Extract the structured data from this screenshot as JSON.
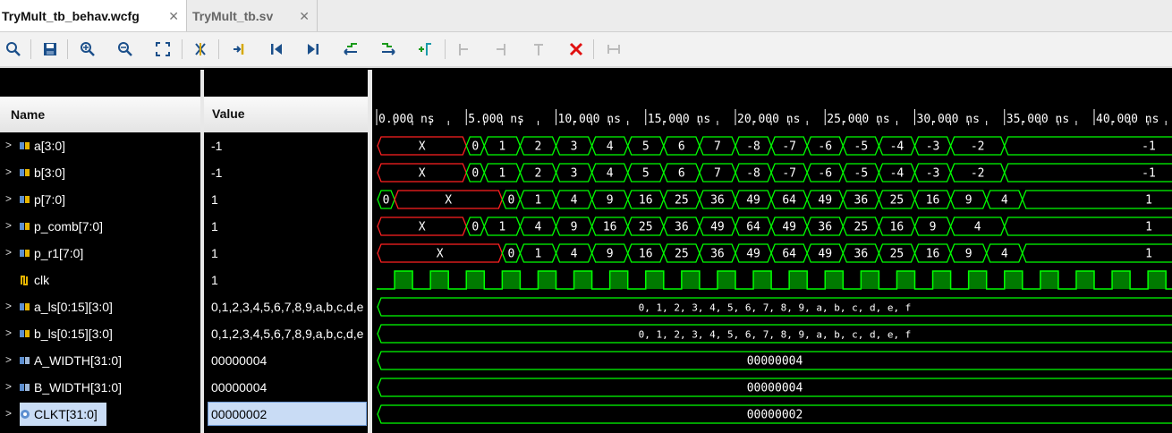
{
  "tabs": [
    {
      "label": "TryMult_tb_behav.wcfg",
      "active": true
    },
    {
      "label": "TryMult_tb.sv",
      "active": false
    }
  ],
  "toolbar_icons": [
    "search-icon",
    "save-icon",
    "zoom-in-icon",
    "zoom-out-icon",
    "zoom-fit-icon",
    "cursor-icon",
    "go-to-cursor-icon",
    "go-to-time-zero-icon",
    "go-to-last-time-icon",
    "previous-transition-icon",
    "next-transition-icon",
    "add-marker-icon",
    "previous-marker-icon",
    "next-marker-icon",
    "swap-cursors-icon",
    "delete-icon",
    "snap-icon"
  ],
  "headers": {
    "name": "Name",
    "value": "Value"
  },
  "colors": {
    "waveform": "#00ff00",
    "x_state": "#ff2020",
    "clock_fill": "#007a00",
    "selection": "#c9dcf5"
  },
  "time_axis": {
    "labels": [
      "0.000 ns",
      "5.000 ns",
      "10.000 ns",
      "15.000 ns",
      "20.000 ns",
      "25.000 ns",
      "30.000 ns",
      "35.000 ns",
      "40.000 ns"
    ],
    "ns_per_tick": 5,
    "visible_range_ns": [
      0,
      44.5
    ]
  },
  "signals": [
    {
      "name": "a[3:0]",
      "value": "-1",
      "icon": "bus-icon",
      "expandable": true,
      "wave": {
        "type": "bus",
        "segs": [
          [
            0,
            5,
            "X"
          ],
          [
            5,
            6,
            "0"
          ],
          [
            6,
            8,
            "1"
          ],
          [
            8,
            10,
            "2"
          ],
          [
            10,
            12,
            "3"
          ],
          [
            12,
            14,
            "4"
          ],
          [
            14,
            16,
            "5"
          ],
          [
            16,
            18,
            "6"
          ],
          [
            18,
            20,
            "7"
          ],
          [
            20,
            22,
            "-8"
          ],
          [
            22,
            24,
            "-7"
          ],
          [
            24,
            26,
            "-6"
          ],
          [
            26,
            28,
            "-5"
          ],
          [
            28,
            30,
            "-4"
          ],
          [
            30,
            32,
            "-3"
          ],
          [
            32,
            35,
            "-2"
          ],
          [
            35,
            null,
            "-1"
          ]
        ]
      }
    },
    {
      "name": "b[3:0]",
      "value": "-1",
      "icon": "bus-icon",
      "expandable": true,
      "wave": {
        "type": "bus",
        "segs": [
          [
            0,
            5,
            "X"
          ],
          [
            5,
            6,
            "0"
          ],
          [
            6,
            8,
            "1"
          ],
          [
            8,
            10,
            "2"
          ],
          [
            10,
            12,
            "3"
          ],
          [
            12,
            14,
            "4"
          ],
          [
            14,
            16,
            "5"
          ],
          [
            16,
            18,
            "6"
          ],
          [
            18,
            20,
            "7"
          ],
          [
            20,
            22,
            "-8"
          ],
          [
            22,
            24,
            "-7"
          ],
          [
            24,
            26,
            "-6"
          ],
          [
            26,
            28,
            "-5"
          ],
          [
            28,
            30,
            "-4"
          ],
          [
            30,
            32,
            "-3"
          ],
          [
            32,
            35,
            "-2"
          ],
          [
            35,
            null,
            "-1"
          ]
        ]
      }
    },
    {
      "name": "p[7:0]",
      "value": "1",
      "icon": "bus-icon",
      "expandable": true,
      "wave": {
        "type": "bus",
        "segs": [
          [
            0,
            1,
            "0"
          ],
          [
            1,
            7,
            "X"
          ],
          [
            7,
            8,
            "0"
          ],
          [
            8,
            10,
            "1"
          ],
          [
            10,
            12,
            "4"
          ],
          [
            12,
            14,
            "9"
          ],
          [
            14,
            16,
            "16"
          ],
          [
            16,
            18,
            "25"
          ],
          [
            18,
            20,
            "36"
          ],
          [
            20,
            22,
            "49"
          ],
          [
            22,
            24,
            "64"
          ],
          [
            24,
            26,
            "49"
          ],
          [
            26,
            28,
            "36"
          ],
          [
            28,
            30,
            "25"
          ],
          [
            30,
            32,
            "16"
          ],
          [
            32,
            34,
            "9"
          ],
          [
            34,
            36,
            "4"
          ],
          [
            36,
            null,
            "1"
          ]
        ]
      }
    },
    {
      "name": "p_comb[7:0]",
      "value": "1",
      "icon": "bus-icon",
      "expandable": true,
      "wave": {
        "type": "bus",
        "segs": [
          [
            0,
            5,
            "X"
          ],
          [
            5,
            6,
            "0"
          ],
          [
            6,
            8,
            "1"
          ],
          [
            8,
            10,
            "4"
          ],
          [
            10,
            12,
            "9"
          ],
          [
            12,
            14,
            "16"
          ],
          [
            14,
            16,
            "25"
          ],
          [
            16,
            18,
            "36"
          ],
          [
            18,
            20,
            "49"
          ],
          [
            20,
            22,
            "64"
          ],
          [
            22,
            24,
            "49"
          ],
          [
            24,
            26,
            "36"
          ],
          [
            26,
            28,
            "25"
          ],
          [
            28,
            30,
            "16"
          ],
          [
            30,
            32,
            "9"
          ],
          [
            32,
            35,
            "4"
          ],
          [
            35,
            null,
            "1"
          ]
        ]
      }
    },
    {
      "name": "p_r1[7:0]",
      "value": "1",
      "icon": "bus-icon",
      "expandable": true,
      "wave": {
        "type": "bus",
        "segs": [
          [
            0,
            7,
            "X"
          ],
          [
            7,
            8,
            "0"
          ],
          [
            8,
            10,
            "1"
          ],
          [
            10,
            12,
            "4"
          ],
          [
            12,
            14,
            "9"
          ],
          [
            14,
            16,
            "16"
          ],
          [
            16,
            18,
            "25"
          ],
          [
            18,
            20,
            "36"
          ],
          [
            20,
            22,
            "49"
          ],
          [
            22,
            24,
            "64"
          ],
          [
            24,
            26,
            "49"
          ],
          [
            26,
            28,
            "36"
          ],
          [
            28,
            30,
            "25"
          ],
          [
            30,
            32,
            "16"
          ],
          [
            32,
            34,
            "9"
          ],
          [
            34,
            36,
            "4"
          ],
          [
            36,
            null,
            "1"
          ]
        ]
      }
    },
    {
      "name": "clk",
      "value": "1",
      "icon": "clock-signal-icon",
      "expandable": false,
      "wave": {
        "type": "clock",
        "period_ns": 2,
        "high_start_ns": 1
      }
    },
    {
      "name": "a_ls[0:15][3:0]",
      "value": "0,1,2,3,4,5,6,7,8,9,a,b,c,d,e",
      "icon": "bus-icon",
      "expandable": true,
      "wave": {
        "type": "bus",
        "segs": [
          [
            0,
            null,
            "0, 1, 2, 3, 4, 5, 6, 7, 8, 9, a, b, c, d, e, f"
          ]
        ]
      }
    },
    {
      "name": "b_ls[0:15][3:0]",
      "value": "0,1,2,3,4,5,6,7,8,9,a,b,c,d,e",
      "icon": "bus-icon",
      "expandable": true,
      "wave": {
        "type": "bus",
        "segs": [
          [
            0,
            null,
            "0, 1, 2, 3, 4, 5, 6, 7, 8, 9, a, b, c, d, e, f"
          ]
        ]
      }
    },
    {
      "name": "A_WIDTH[31:0]",
      "value": "00000004",
      "icon": "parameter-icon",
      "expandable": true,
      "wave": {
        "type": "bus",
        "segs": [
          [
            0,
            null,
            "00000004"
          ]
        ]
      }
    },
    {
      "name": "B_WIDTH[31:0]",
      "value": "00000004",
      "icon": "parameter-icon",
      "expandable": true,
      "wave": {
        "type": "bus",
        "segs": [
          [
            0,
            null,
            "00000004"
          ]
        ]
      }
    },
    {
      "name": "CLKT[31:0]",
      "value": "00000002",
      "icon": "constant-icon",
      "expandable": true,
      "selected": true,
      "wave": {
        "type": "bus",
        "segs": [
          [
            0,
            null,
            "00000002"
          ]
        ]
      }
    }
  ]
}
